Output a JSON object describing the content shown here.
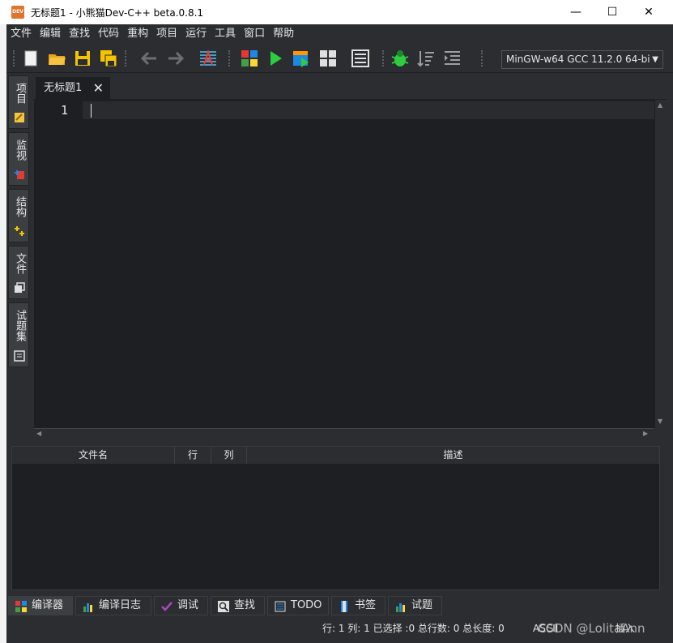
{
  "window": {
    "title": "无标题1 - 小熊猫Dev-C++ beta.0.8.1",
    "app_icon_text": "DEV",
    "minimize": "—",
    "maximize": "☐",
    "close": "✕"
  },
  "menu": [
    "文件",
    "编辑",
    "查找",
    "代码",
    "重构",
    "项目",
    "运行",
    "工具",
    "窗口",
    "帮助"
  ],
  "toolbar": {
    "compiler_selected": "MinGW-w64 GCC 11.2.0 64-bi",
    "icons": [
      "new-file-icon",
      "open-folder-icon",
      "save-icon",
      "save-all-icon",
      "back-arrow-icon",
      "forward-arrow-icon",
      "format-code-icon",
      "compile-icon",
      "run-icon",
      "compile-run-icon",
      "rebuild-icon",
      "toggle-view-icon",
      "debug-bug-icon",
      "sort-icon",
      "indent-icon"
    ]
  },
  "side_tabs": [
    {
      "label": "项目",
      "icon": "project-icon"
    },
    {
      "label": "监视",
      "icon": "watch-icon"
    },
    {
      "label": "结构",
      "icon": "structure-icon"
    },
    {
      "label": "文件",
      "icon": "files-icon"
    },
    {
      "label": "试题集",
      "icon": "problem-set-icon"
    }
  ],
  "editor": {
    "tab_label": "无标题1",
    "tab_close": "✕",
    "line_numbers": [
      "1"
    ]
  },
  "messages_table": {
    "columns": [
      "文件名",
      "行",
      "列",
      "描述"
    ]
  },
  "bottom_tabs": [
    {
      "label": "编译器",
      "icon": "compiler-grid-icon",
      "active": true
    },
    {
      "label": "编译日志",
      "icon": "bar-chart-icon",
      "active": false
    },
    {
      "label": "调试",
      "icon": "check-icon",
      "active": false
    },
    {
      "label": "查找",
      "icon": "magnifier-icon",
      "active": false
    },
    {
      "label": "TODO",
      "icon": "todo-icon",
      "active": false
    },
    {
      "label": "书签",
      "icon": "bookmark-icon",
      "active": false
    },
    {
      "label": "试题",
      "icon": "problems-chart-icon",
      "active": false
    }
  ],
  "status": {
    "position": "行: 1 列: 1 已选择 :0 总行数: 0 总长度: 0",
    "encoding": "ASCII",
    "insert_mode": "插入"
  },
  "watermark": "CSDN @LolitaAnn"
}
